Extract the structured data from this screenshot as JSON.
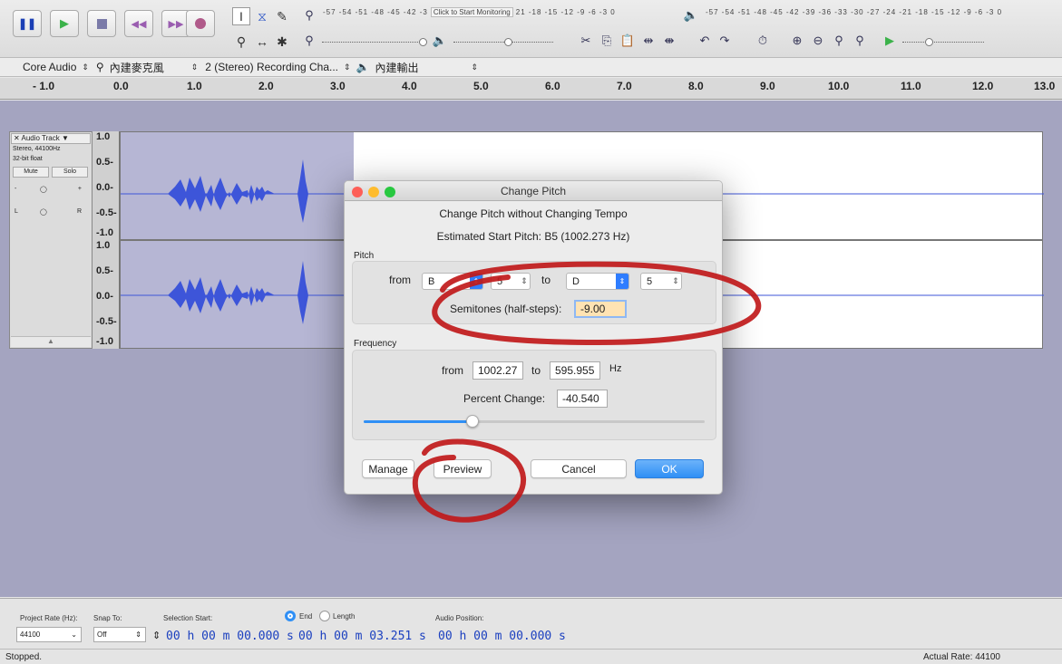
{
  "toolbar": {
    "meters": {
      "record_label": "Click to Start Monitoring",
      "record_ticks": "-57 -54 -51 -48 -45 -42 -3",
      "record_ticks_right": "21 -18 -15 -12 -9 -6 -3 0",
      "play_ticks": "-57 -54 -51 -48 -45 -42 -39 -36 -33 -30 -27 -24 -21 -18 -15 -12 -9 -6 -3 0"
    }
  },
  "devices": {
    "host": "Core Audio",
    "input": "內建麥克風",
    "channels": "2 (Stereo) Recording Cha...",
    "output": "內建輸出"
  },
  "ruler": {
    "ticks": [
      "- 1.0",
      "0.0",
      "1.0",
      "2.0",
      "3.0",
      "4.0",
      "5.0",
      "6.0",
      "7.0",
      "8.0",
      "9.0",
      "10.0",
      "11.0",
      "12.0",
      "13.0"
    ]
  },
  "track": {
    "name": "Audio Track",
    "info_line1": "Stereo, 44100Hz",
    "info_line2": "32-bit float",
    "mute": "Mute",
    "solo": "Solo",
    "gain_minus": "-",
    "gain_plus": "+",
    "pan_left": "L",
    "pan_right": "R",
    "scale": [
      "1.0",
      "0.5-",
      "0.0-",
      "-0.5-",
      "-1.0"
    ]
  },
  "dialog": {
    "title": "Change Pitch",
    "heading": "Change Pitch without Changing Tempo",
    "estimated": "Estimated Start Pitch: B5 (1002.273 Hz)",
    "pitch_group": "Pitch",
    "from_label": "from",
    "from_note": "B",
    "from_octave": "5",
    "to_label": "to",
    "to_note": "D",
    "to_octave": "5",
    "semitones_label": "Semitones (half-steps):",
    "semitones_value": "-9.00",
    "freq_group": "Frequency",
    "freq_from_label": "from",
    "freq_from": "1002.27",
    "freq_to_label": "to",
    "freq_to": "595.955",
    "hz": "Hz",
    "percent_label": "Percent Change:",
    "percent_value": "-40.540",
    "percent_slider_fraction": 0.32,
    "manage": "Manage",
    "preview": "Preview",
    "cancel": "Cancel",
    "ok": "OK"
  },
  "bottom": {
    "project_rate_label": "Project Rate (Hz):",
    "project_rate": "44100",
    "snap_label": "Snap To:",
    "snap": "Off",
    "selection_start_label": "Selection Start:",
    "end_label": "End",
    "length_label": "Length",
    "audio_position_label": "Audio Position:",
    "sel_start": "00 h 00 m 00.000 s",
    "sel_end": "00 h 00 m 03.251 s",
    "audio_pos": "00 h 00 m 00.000 s"
  },
  "status": {
    "left": "Stopped.",
    "right": "Actual Rate: 44100"
  },
  "colors": {
    "accent": "#2f8ff5",
    "waveform": "#3d55d9",
    "annotation": "#c0191a"
  }
}
